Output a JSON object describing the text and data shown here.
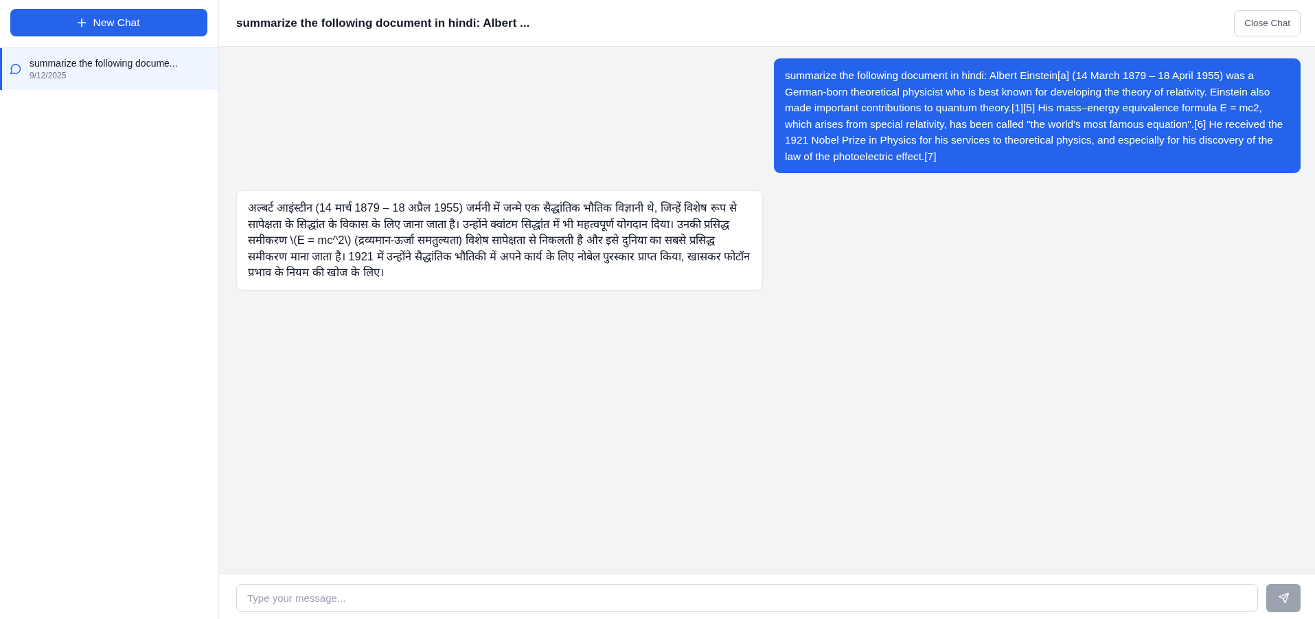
{
  "sidebar": {
    "new_chat_button": {
      "label": "New Chat"
    },
    "chats": [
      {
        "title": "summarize the following docume...",
        "date": "9/12/2025",
        "selected": true
      }
    ]
  },
  "header": {
    "title": "summarize the following document in hindi: Albert ...",
    "close_button": {
      "label": "Close Chat"
    }
  },
  "messages": [
    {
      "kind": "user",
      "text": "summarize the following document in hindi: Albert Einstein[a] (14 March 1879 – 18 April 1955) was a German-born theoretical physicist who is best known for developing the theory of relativity. Einstein also made important contributions to quantum theory.[1][5] His mass–energy equivalence formula E = mc2, which arises from special relativity, has been called \"the world's most famous equation\".[6] He received the 1921 Nobel Prize in Physics for his services to theoretical physics, and especially for his discovery of the law of the photoelectric effect.[7]"
    },
    {
      "kind": "assistant",
      "text": "अल्बर्ट आइंस्टीन (14 मार्च 1879 – 18 अप्रैल 1955) जर्मनी में जन्मे एक सैद्धांतिक भौतिक विज्ञानी थे, जिन्हें विशेष रूप से सापेक्षता के सिद्धांत के विकास के लिए जाना जाता है। उन्होंने क्वांटम सिद्धांत में भी महत्वपूर्ण योगदान दिया। उनकी प्रसिद्ध समीकरण \\(E = mc^2\\) (द्रव्यमान-ऊर्जा समतुल्यता) विशेष सापेक्षता से निकलती है और इसे दुनिया का सबसे प्रसिद्ध समीकरण माना जाता है। 1921 में उन्होंने सैद्धांतिक भौतिकी में अपने कार्य के लिए नोबेल पुरस्कार प्राप्त किया, खासकर फोटॉन प्रभाव के नियम की खोज के लिए।"
    }
  ],
  "composer": {
    "placeholder": "Type your message...",
    "send_button": {
      "disabled": true
    }
  }
}
